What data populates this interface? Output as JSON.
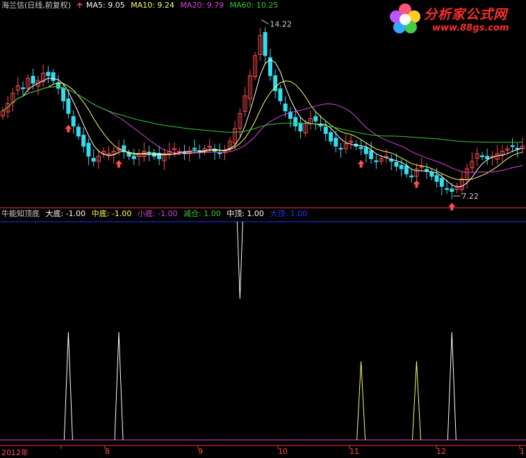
{
  "header": {
    "title": "海兰信(日线,前复权)",
    "ma5": "MA5: 9.05",
    "ma10": "MA10: 9.24",
    "ma20": "MA20: 9.79",
    "ma60": "MA60: 10.25"
  },
  "indicator": {
    "name": "牛能知顶底",
    "dadi": "大底: -1.00",
    "zhongdi": "中底: -1.00",
    "xiaodi": "小底: -1.00",
    "jiancang": "减仓: 1.00",
    "zhongding": "中顶: 1.00",
    "dading": "大顶: 1.00"
  },
  "logo": {
    "text": "分析家公式网",
    "url": "www.88gs.com"
  },
  "colors": {
    "up": "#ff4d4d",
    "down": "#33ddee",
    "ma5": "#ffffff",
    "ma10": "#ffff66",
    "ma20": "#dd44dd",
    "ma60": "#33cc33",
    "axis": "#ff3333",
    "blue": "#2233ff",
    "magenta": "#dd44dd"
  },
  "chart_data": [
    {
      "type": "candlestick",
      "title": "海兰信(日线,前复权)",
      "annotations": [
        {
          "label": "14.22",
          "value": 14.22,
          "kind": "high"
        },
        {
          "label": "7.22",
          "value": 7.22,
          "kind": "low"
        }
      ],
      "x_ticks": [
        "2012年",
        "8",
        "9",
        "10",
        "11",
        "12",
        "1"
      ],
      "close": [
        10.6,
        10.9,
        11.3,
        11.6,
        11.5,
        11.9,
        11.7,
        11.8,
        12.1,
        12.0,
        11.8,
        11.5,
        11.0,
        10.5,
        10.0,
        9.6,
        9.2,
        8.8,
        8.6,
        8.8,
        9.0,
        8.9,
        9.0,
        9.1,
        9.0,
        8.8,
        8.7,
        8.9,
        9.0,
        8.9,
        8.8,
        8.7,
        8.9,
        9.0,
        9.1,
        9.0,
        8.9,
        9.0,
        9.1,
        9.0,
        9.1,
        9.2,
        9.0,
        8.9,
        9.0,
        9.4,
        9.9,
        10.5,
        11.2,
        12.0,
        12.8,
        13.6,
        12.8,
        12.0,
        11.4,
        11.0,
        10.6,
        10.3,
        10.0,
        9.8,
        10.1,
        10.3,
        10.2,
        10.0,
        9.7,
        9.4,
        9.2,
        9.1,
        9.3,
        9.4,
        9.2,
        9.1,
        8.9,
        8.7,
        8.6,
        8.7,
        8.8,
        8.6,
        8.4,
        8.3,
        8.1,
        8.0,
        8.3,
        8.4,
        8.2,
        8.0,
        7.8,
        7.6,
        7.5,
        7.4,
        7.6,
        7.9,
        8.3,
        8.6,
        8.9,
        8.8,
        8.7,
        8.8,
        8.9,
        9.0,
        9.1,
        9.2,
        9.1,
        9.2
      ]
    },
    {
      "type": "line",
      "title": "牛能知顶底",
      "ylim": [
        -1,
        1
      ],
      "series": [
        {
          "name": "大顶",
          "values": [
            {
              "x": 47,
              "y": 1
            }
          ]
        },
        {
          "name": "大底",
          "values": [
            {
              "x": 13,
              "y": -1
            },
            {
              "x": 23,
              "y": -1
            },
            {
              "x": 89,
              "y": -1
            }
          ]
        },
        {
          "name": "中底",
          "values": [
            {
              "x": 71,
              "y": -1
            },
            {
              "x": 82,
              "y": -1
            }
          ]
        }
      ]
    }
  ]
}
